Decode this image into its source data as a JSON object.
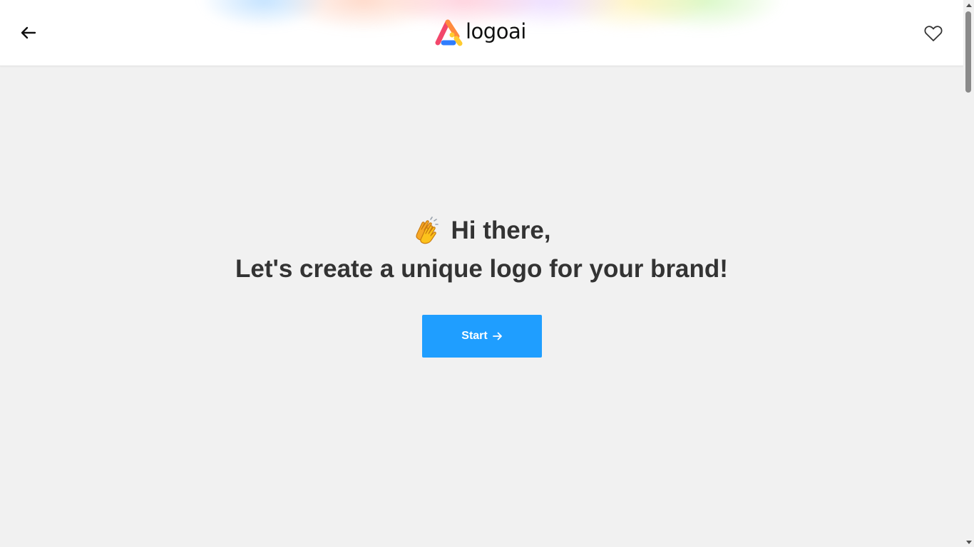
{
  "header": {
    "back_icon": "arrow-left-icon",
    "logo_text": "logoai",
    "favorite_icon": "heart-outline-icon"
  },
  "hero": {
    "greeting_icon": "clapping-hands-emoji",
    "greeting": "Hi there,",
    "headline": "Let's create a unique logo for your brand!",
    "start_label": "Start",
    "start_icon": "arrow-right-icon"
  },
  "colors": {
    "primary_button": "#1f9eff",
    "page_background": "#f1f1f1",
    "header_background": "#ffffff",
    "heading_text": "#333333",
    "logo_red": "#f2476b",
    "logo_yellow": "#ffcb2f",
    "logo_blue": "#2f7dfd"
  }
}
